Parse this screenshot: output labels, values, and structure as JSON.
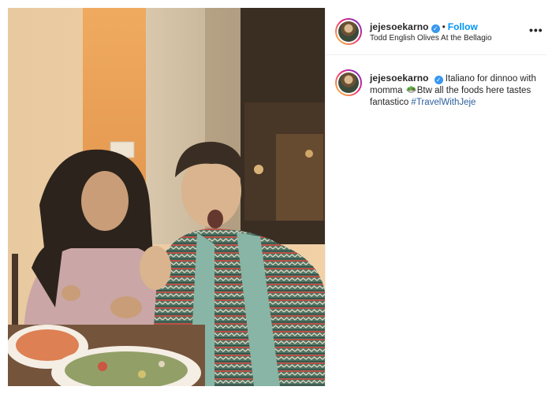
{
  "post": {
    "username": "jejesoekarno",
    "verified": true,
    "header_separator": "•",
    "follow_label": "Follow",
    "location": "Todd English Olives At the Bellagio",
    "more_label": "•••",
    "caption": {
      "text_before_emoji": "Italiano for dinnoo with momma ",
      "emoji": "salad-emoji",
      "text_after_emoji": "Btw all the foods here tastes fantastico ",
      "hashtag": "#TravelWithJeje"
    },
    "colors": {
      "follow": "#0095f6",
      "hashtag": "#2b5f9e",
      "verified": "#3897f0"
    }
  }
}
